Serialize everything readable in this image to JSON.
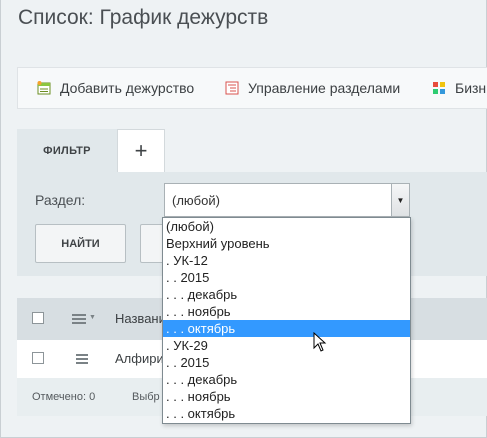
{
  "page": {
    "title": "Список: График дежурств"
  },
  "toolbar": {
    "items": [
      {
        "label": "Добавить дежурство",
        "icon": "add-duty-icon"
      },
      {
        "label": "Управление разделами",
        "icon": "sections-icon"
      },
      {
        "label": "Бизн",
        "icon": "business-icon"
      }
    ]
  },
  "filter": {
    "tab_label": "ФИЛЬТР",
    "add_tab_label": "+",
    "section_label": "Раздел:",
    "section_value": "(любой)",
    "find_button": "НАЙТИ",
    "options": [
      {
        "label": "(любой)",
        "selected": false
      },
      {
        "label": "Верхний уровень",
        "selected": false
      },
      {
        "label": ". УК-12",
        "selected": false
      },
      {
        "label": ". . 2015",
        "selected": false
      },
      {
        "label": ". . . декабрь",
        "selected": false
      },
      {
        "label": ". . . ноябрь",
        "selected": false
      },
      {
        "label": ". . . октябрь",
        "selected": true
      },
      {
        "label": ". УК-29",
        "selected": false
      },
      {
        "label": ". . 2015",
        "selected": false
      },
      {
        "label": ". . . декабрь",
        "selected": false
      },
      {
        "label": ". . . ноябрь",
        "selected": false
      },
      {
        "label": ". . . октябрь",
        "selected": false
      }
    ]
  },
  "grid": {
    "header_name": "Названи",
    "row_name": "Алфири",
    "footer_marked": "Отмечено: 0",
    "footer_selected": "Выбр"
  },
  "colors": {
    "selection": "#3399ff",
    "panel": "#e1e8eb",
    "page_bg": "#eef2f4"
  }
}
